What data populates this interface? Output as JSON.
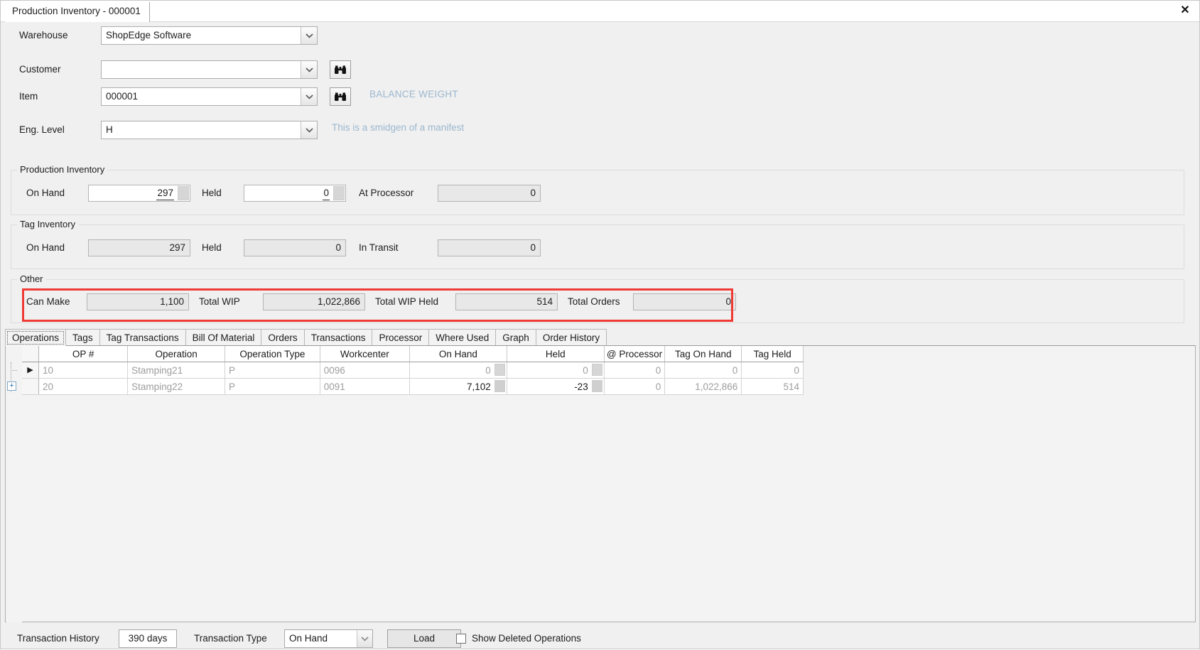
{
  "window": {
    "tab_title": "Production Inventory - 000001",
    "close_icon": "close-icon",
    "close_label": "✕"
  },
  "form": {
    "warehouse": {
      "label": "Warehouse",
      "value": "ShopEdge Software"
    },
    "customer": {
      "label": "Customer",
      "value": "",
      "lookup_icon": "binoculars-icon"
    },
    "item": {
      "label": "Item",
      "value": "000001",
      "lookup_icon": "binoculars-icon",
      "hint": "BALANCE WEIGHT"
    },
    "eng_level": {
      "label": "Eng. Level",
      "value": "H",
      "hint": "This is a smidgen of a manifest"
    }
  },
  "production_inventory": {
    "title": "Production Inventory",
    "on_hand": {
      "label": "On Hand",
      "value": "297"
    },
    "held": {
      "label": "Held",
      "value": "0"
    },
    "at_processor": {
      "label": "At Processor",
      "value": "0"
    }
  },
  "tag_inventory": {
    "title": "Tag Inventory",
    "on_hand": {
      "label": "On Hand",
      "value": "297"
    },
    "held": {
      "label": "Held",
      "value": "0"
    },
    "in_transit": {
      "label": "In Transit",
      "value": "0"
    }
  },
  "other": {
    "title": "Other",
    "highlight_color": "#ef3b34",
    "can_make": {
      "label": "Can Make",
      "value": "1,100"
    },
    "total_wip": {
      "label": "Total WIP",
      "value": "1,022,866"
    },
    "total_wip_held": {
      "label": "Total WIP Held",
      "value": "514"
    },
    "total_orders": {
      "label": "Total Orders",
      "value": "0"
    }
  },
  "tabs": {
    "active_index": 0,
    "items": [
      {
        "label": "Operations"
      },
      {
        "label": "Tags"
      },
      {
        "label": "Tag Transactions"
      },
      {
        "label": "Bill Of Material"
      },
      {
        "label": "Orders"
      },
      {
        "label": "Transactions"
      },
      {
        "label": "Processor"
      },
      {
        "label": "Where Used"
      },
      {
        "label": "Graph"
      },
      {
        "label": "Order History"
      }
    ]
  },
  "grid": {
    "columns": [
      "OP #",
      "Operation",
      "Operation Type",
      "Workcenter",
      "On Hand",
      "Held",
      "@ Processor",
      "Tag On Hand",
      "Tag Held"
    ],
    "rows": [
      {
        "selector": "▶",
        "op": "10",
        "operation": "Stamping21",
        "operation_type": "P",
        "workcenter": "0096",
        "on_hand": "0",
        "held": "0",
        "at_processor": "0",
        "tag_on_hand": "0",
        "tag_held": "0"
      },
      {
        "selector": "",
        "op": "20",
        "operation": "Stamping22",
        "operation_type": "P",
        "workcenter": "0091",
        "on_hand": "7,102",
        "held": "-23",
        "at_processor": "0",
        "tag_on_hand": "1,022,866",
        "tag_held": "514",
        "expander": "+"
      }
    ]
  },
  "bottom_bar": {
    "transaction_history_label": "Transaction History",
    "transaction_history_value": "390 days",
    "transaction_type_label": "Transaction Type",
    "transaction_type_value": "On Hand",
    "load_label": "Load",
    "show_deleted_label": "Show Deleted Operations",
    "show_deleted_checked": false
  }
}
